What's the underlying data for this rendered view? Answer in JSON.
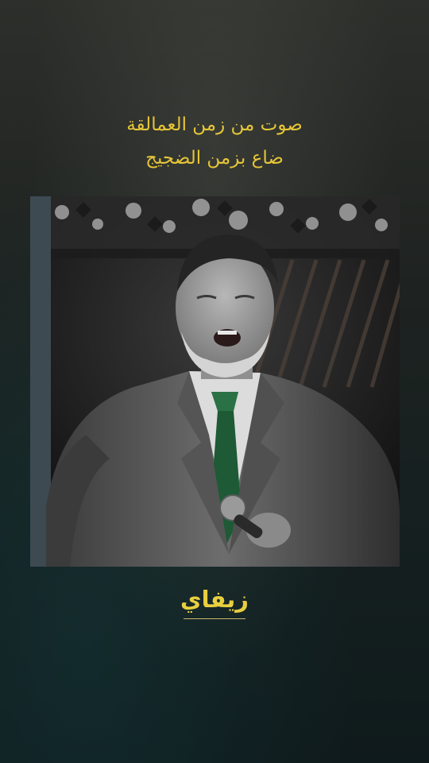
{
  "caption": {
    "line1": "صوت من زمن العمالقة",
    "line2": "ضاع بزمن الضجيج"
  },
  "photo": {
    "subject": "singer-performing-photo"
  },
  "name_tag": {
    "text": "زيفاي"
  },
  "colors": {
    "caption_text": "#e6c638",
    "name_text": "#e9cf3f",
    "background_top": "#2d2f2b",
    "background_bottom": "#0f1a1c",
    "tie": "#1d5a35"
  }
}
